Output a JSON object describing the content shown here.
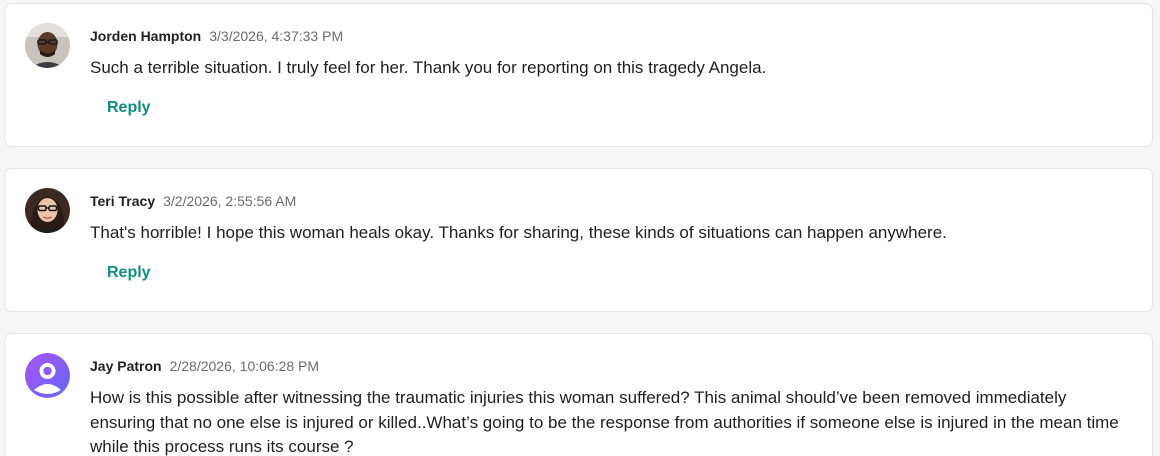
{
  "accent_color": "#128c7e",
  "comments": [
    {
      "author": "Jorden Hampton",
      "timestamp": "3/3/2026, 4:37:33 PM",
      "text": "Such a terrible situation. I truly feel for her. Thank you for reporting on this tragedy Angela.",
      "reply_label": "Reply",
      "avatar_icon": "user-photo-avatar"
    },
    {
      "author": "Teri Tracy",
      "timestamp": "3/2/2026, 2:55:56 AM",
      "text": "That's horrible! I hope this woman heals okay. Thanks for sharing, these kinds of situations can happen anywhere.",
      "reply_label": "Reply",
      "avatar_icon": "user-photo-avatar"
    },
    {
      "author": "Jay Patron",
      "timestamp": "2/28/2026, 10:06:28 PM",
      "text": "How is this possible after witnessing the traumatic injuries this woman suffered? This animal should’ve been removed immediately ensuring that no one else is injured or killed..What’s going to be the response from authorities if someone else is injured in the mean time while this process runs its course ?",
      "avatar_icon": "default-user-avatar"
    }
  ]
}
